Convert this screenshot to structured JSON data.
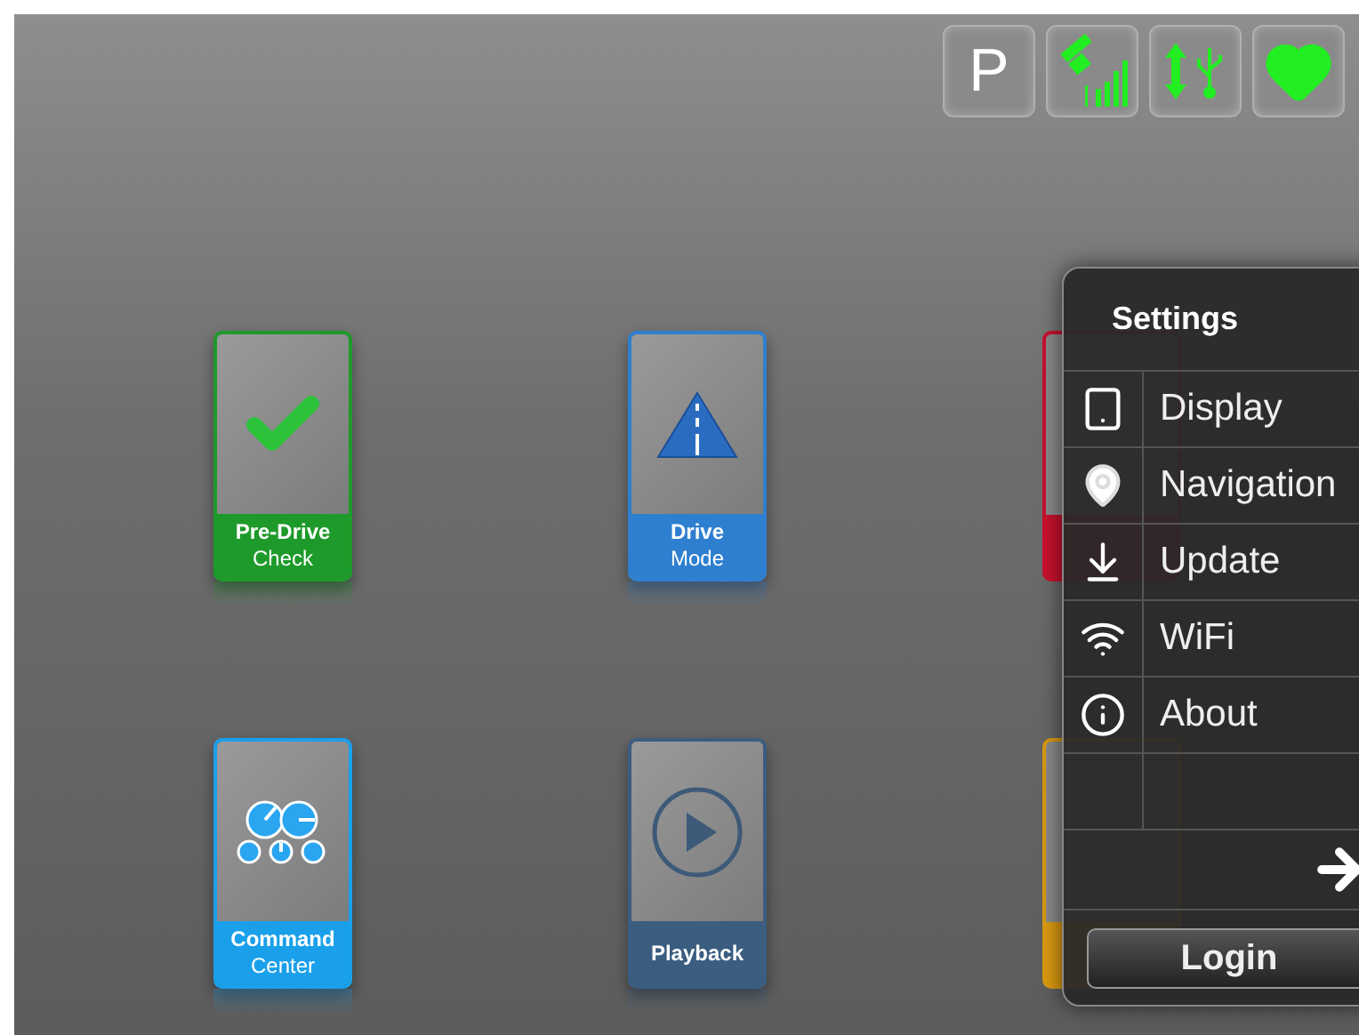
{
  "status_icons": [
    {
      "kind": "parking",
      "label": "P"
    },
    {
      "kind": "gps"
    },
    {
      "kind": "usb"
    },
    {
      "kind": "heart"
    }
  ],
  "tiles": [
    {
      "kind": "check",
      "title": "Pre-Drive",
      "subtitle": "Check",
      "color": "#1e9a2a"
    },
    {
      "kind": "road",
      "title": "Drive",
      "subtitle": "Mode",
      "color": "#2f7fd0"
    },
    {
      "kind": "partial",
      "color": "#c8102e"
    },
    {
      "kind": "command",
      "title": "Command",
      "subtitle": "Center",
      "color": "#1aa0ea"
    },
    {
      "kind": "play",
      "title": "Playback",
      "color": "#3a5d80"
    },
    {
      "kind": "partial",
      "color": "#d99a10"
    }
  ],
  "settings": {
    "title": "Settings",
    "items": [
      {
        "kind": "display",
        "label": "Display"
      },
      {
        "kind": "pin",
        "label": "Navigation"
      },
      {
        "kind": "update",
        "label": "Update"
      },
      {
        "kind": "wifi",
        "label": "WiFi"
      },
      {
        "kind": "about",
        "label": "About"
      }
    ],
    "login": "Login"
  }
}
